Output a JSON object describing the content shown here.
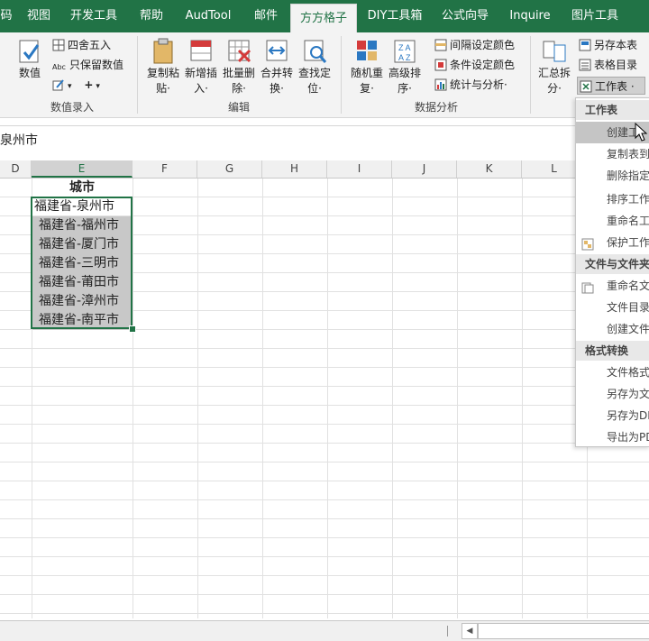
{
  "tabs": [
    "码",
    "视图",
    "开发工具",
    "帮助",
    "AudTool",
    "邮件",
    "方方格子",
    "DIY工具箱",
    "公式向导",
    "Inquire",
    "图片工具"
  ],
  "active_tab": "方方格子",
  "ribbon": {
    "group1": {
      "label": "数值录入",
      "numeric": "数值",
      "round": "四舍五入",
      "keep_value": "只保留数值",
      "plus": "+"
    },
    "group2": {
      "label": "编辑",
      "copy_paste": [
        "复制粘",
        "贴·"
      ],
      "new_insert": [
        "新增插",
        "入·"
      ],
      "batch_delete": [
        "批量删",
        "除·"
      ],
      "merge_convert": [
        "合并转",
        "换·"
      ],
      "find_locate": [
        "查找定",
        "位·"
      ]
    },
    "group3": {
      "label": "数据分析",
      "random_dup": [
        "随机重",
        "复·"
      ],
      "advanced_sort": [
        "高级排",
        "序·"
      ],
      "interval_color": "间隔设定颜色",
      "cond_color": "条件设定颜色",
      "stats": "统计与分析·"
    },
    "group4": {
      "summary_split": [
        "汇总拆",
        "分·"
      ],
      "save_as_table": "另存本表",
      "table_directory": "表格目录",
      "worksheet": "工作表 ·"
    }
  },
  "formula": "泉州市",
  "columns": [
    "D",
    "E",
    "F",
    "G",
    "H",
    "I",
    "J",
    "K",
    "L"
  ],
  "header_cell": "城市",
  "cities": [
    "福建省-泉州市",
    "福建省-福州市",
    "福建省-厦门市",
    "福建省-三明市",
    "福建省-莆田市",
    "福建省-漳州市",
    "福建省-南平市"
  ],
  "menu": {
    "section1": "工作表",
    "items1": [
      "创建工",
      "复制表到",
      "删除指定",
      "排序工作",
      "重命名工",
      "保护工作"
    ],
    "section2": "文件与文件夹",
    "items2": [
      "重命名文",
      "文件目录",
      "创建文件"
    ],
    "section3": "格式转换",
    "items3": [
      "文件格式",
      "另存为文",
      "另存为DI",
      "导出为PD"
    ]
  },
  "colors": {
    "accent": "#217346",
    "selection": "#c8c8c8",
    "ribbon": "#f3f3f3"
  }
}
